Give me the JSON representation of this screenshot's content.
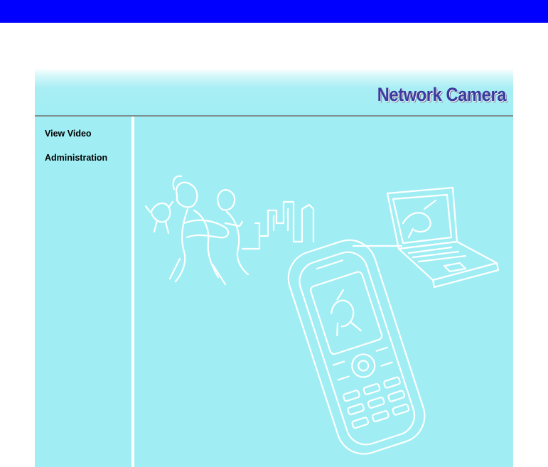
{
  "header": {
    "brand_title": "Network Camera"
  },
  "sidebar": {
    "items": [
      {
        "label": "View Video"
      },
      {
        "label": "Administration"
      }
    ]
  },
  "colors": {
    "top_bar": "#0000ff",
    "background": "#a0eef4",
    "brand_text": "#3b3a9e",
    "separator": "#ffffff"
  },
  "illustration": {
    "subject": "people-mobile-phone-laptop-sketch"
  }
}
